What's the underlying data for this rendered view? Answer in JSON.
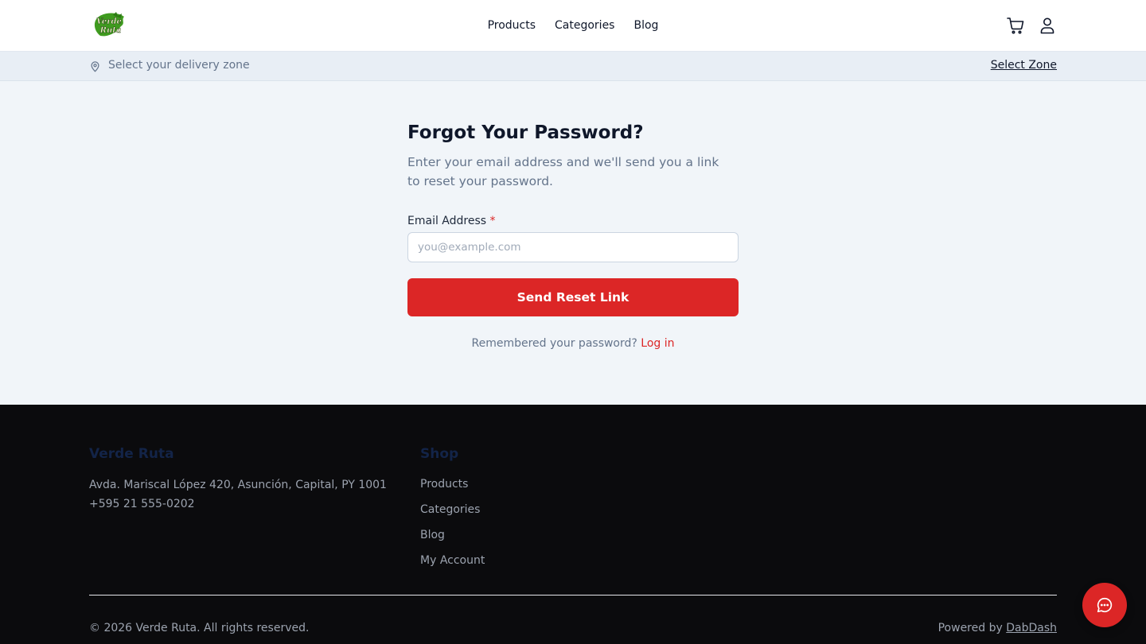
{
  "header": {
    "logo_text": "Verde Ruta",
    "nav": [
      {
        "label": "Products"
      },
      {
        "label": "Categories"
      },
      {
        "label": "Blog"
      }
    ],
    "icons": [
      "cart-icon",
      "user-icon"
    ]
  },
  "zone": {
    "text": "Select your delivery zone",
    "link": "Select Zone",
    "icon": "map-pin-icon"
  },
  "form": {
    "title": "Forgot Your Password?",
    "subtitle": "Enter your email address and we'll send you a link to reset your password.",
    "email_label": "Email Address",
    "required_mark": "*",
    "email_value": "",
    "email_placeholder": "you@example.com",
    "submit_label": "Send Reset Link",
    "remember_text": "Remembered your password?",
    "login_link": "Log in"
  },
  "footer": {
    "brand": "Verde Ruta",
    "address": "Avda. Mariscal López 420, Asunción, Capital, PY 1001",
    "phone": "+595 21 555-0202",
    "shop_heading": "Shop",
    "shop_links": [
      {
        "label": "Products"
      },
      {
        "label": "Categories"
      },
      {
        "label": "Blog"
      },
      {
        "label": "My Account"
      }
    ],
    "copyright": "© 2026 Verde Ruta. All rights reserved.",
    "powered_prefix": "Powered by",
    "powered_link": "DabDash"
  },
  "chat": {
    "icon": "chat-bubble-icon"
  },
  "colors": {
    "accent": "#dc2626",
    "footer_bg": "#0b0b0d",
    "page_bg": "#f1f5f9",
    "logo_green": "#3f9b1f"
  }
}
